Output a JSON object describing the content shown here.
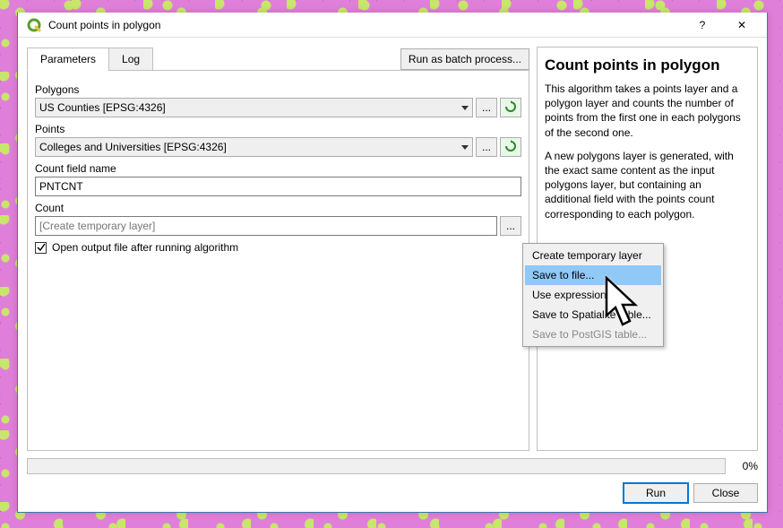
{
  "window": {
    "title": "Count points in polygon",
    "help_tip": "?",
    "close_tip": "✕"
  },
  "tabs": {
    "parameters": "Parameters",
    "log": "Log"
  },
  "batch_button": "Run as batch process...",
  "form": {
    "polygons_label": "Polygons",
    "polygons_value": "US Counties [EPSG:4326]",
    "points_label": "Points",
    "points_value": "Colleges and Universities [EPSG:4326]",
    "countfield_label": "Count field name",
    "countfield_value": "PNTCNT",
    "output_label": "Count",
    "output_placeholder": "[Create temporary layer]",
    "open_after_label": "Open output file after running algorithm",
    "open_after_checked": true,
    "browse_btn": "...",
    "refresh_tip": "↻"
  },
  "help": {
    "title": "Count points in polygon",
    "p1": "This algorithm takes a points layer and a polygon layer and counts the number of points from the first one in each polygons of the second one.",
    "p2": "A new polygons layer is generated, with the exact same content as the input polygons layer, but containing an additional field with the points count corresponding to each polygon."
  },
  "context_menu": {
    "items": [
      {
        "label": "Create temporary layer",
        "enabled": true,
        "hover": false
      },
      {
        "label": "Save to file...",
        "enabled": true,
        "hover": true
      },
      {
        "label": "Use expression...",
        "enabled": true,
        "hover": false
      },
      {
        "label": "Save to Spatialite table...",
        "enabled": true,
        "hover": false
      },
      {
        "label": "Save to PostGIS table...",
        "enabled": false,
        "hover": false
      }
    ]
  },
  "progress": {
    "percent": "0%"
  },
  "buttons": {
    "run": "Run",
    "close": "Close"
  }
}
